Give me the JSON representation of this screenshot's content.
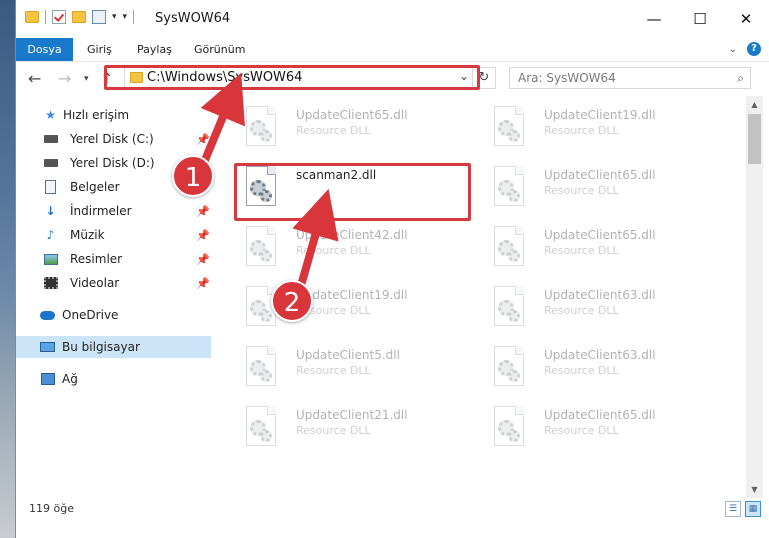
{
  "window": {
    "title": "SysWOW64",
    "controls": {
      "minimize": "—",
      "maximize": "☐",
      "close": "✕"
    }
  },
  "ribbon": {
    "tabs": [
      "Dosya",
      "Giriş",
      "Paylaş",
      "Görünüm"
    ],
    "help": "?"
  },
  "address_bar": {
    "path": "C:\\Windows\\SysWOW64",
    "search_placeholder": "Ara: SysWOW64"
  },
  "sidebar": {
    "items": [
      {
        "label": "Hızlı erişim",
        "icon": "star-icon"
      },
      {
        "label": "Yerel Disk (C:)",
        "icon": "disk-icon",
        "pinned": true
      },
      {
        "label": "Yerel Disk (D:)",
        "icon": "disk-icon",
        "pinned": true
      },
      {
        "label": "Belgeler",
        "icon": "document-icon",
        "pinned": true
      },
      {
        "label": "İndirmeler",
        "icon": "download-icon",
        "pinned": true
      },
      {
        "label": "Müzik",
        "icon": "music-icon",
        "pinned": true
      },
      {
        "label": "Resimler",
        "icon": "picture-icon",
        "pinned": true
      },
      {
        "label": "Videolar",
        "icon": "video-icon",
        "pinned": true
      },
      {
        "label": "OneDrive",
        "icon": "cloud-icon"
      },
      {
        "label": "Bu bilgisayar",
        "icon": "computer-icon",
        "selected": true
      },
      {
        "label": "Ağ",
        "icon": "network-icon"
      }
    ]
  },
  "files": {
    "left": [
      {
        "name": "UpdateClient65.dll",
        "type": "Resource DLL"
      },
      {
        "name": "scanman2.dll",
        "type": ""
      },
      {
        "name": "UpdateClient42.dll",
        "type": "Resource DLL"
      },
      {
        "name": "UpdateClient19.dll",
        "type": "Resource DLL"
      },
      {
        "name": "UpdateClient5.dll",
        "type": "Resource DLL"
      },
      {
        "name": "UpdateClient21.dll",
        "type": "Resource DLL"
      }
    ],
    "right": [
      {
        "name": "UpdateClient19.dll",
        "type": "Resource DLL"
      },
      {
        "name": "UpdateClient65.dll",
        "type": "Resource DLL"
      },
      {
        "name": "UpdateClient65.dll",
        "type": "Resource DLL"
      },
      {
        "name": "UpdateClient63.dll",
        "type": "Resource DLL"
      },
      {
        "name": "UpdateClient63.dll",
        "type": "Resource DLL"
      },
      {
        "name": "UpdateClient65.dll",
        "type": "Resource DLL"
      }
    ]
  },
  "status": {
    "item_count": "119 öğe"
  },
  "callouts": {
    "one": "1",
    "two": "2",
    "color": "#d9363b"
  }
}
